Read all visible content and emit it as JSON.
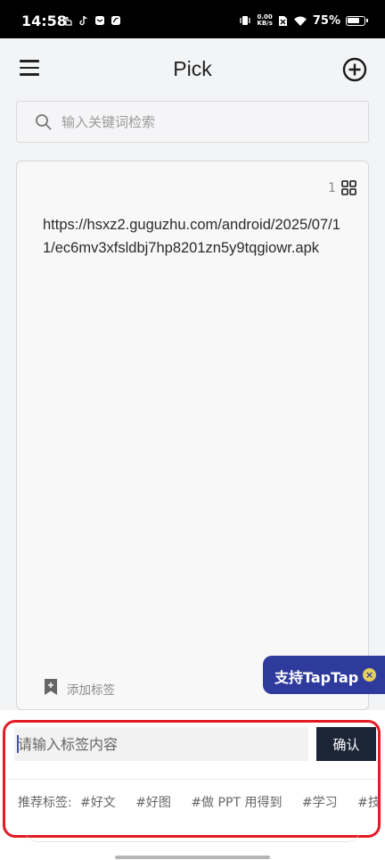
{
  "status_bar": {
    "time": "14:58",
    "net_speed_value": "0.00",
    "net_speed_unit": "KB/s",
    "battery_percent": "75%"
  },
  "header": {
    "title": "Pick"
  },
  "search": {
    "placeholder": "输入关键词检索"
  },
  "card": {
    "count": "1",
    "url": "https://hsxz2.guguzhu.com/android/2025/07/11/ec6mv3xfsldbj7hp8201zn5y9tqgiowr.apk",
    "add_tag_label": "添加标签"
  },
  "taptap": {
    "label": "支持TapTap"
  },
  "tag_sheet": {
    "input_placeholder": "请输入标签内容",
    "confirm_label": "确认",
    "recommend_label": "推荐标签:",
    "recommended_tags": [
      "#好文",
      "#好图",
      "#做 PPT 用得到",
      "#学习",
      "#技术"
    ]
  },
  "colors": {
    "overlay_bg": "#f3f4f6",
    "confirm_bg": "#1c2536",
    "taptap_bg": "#2f3b9c",
    "highlight_border": "#e21b24"
  }
}
